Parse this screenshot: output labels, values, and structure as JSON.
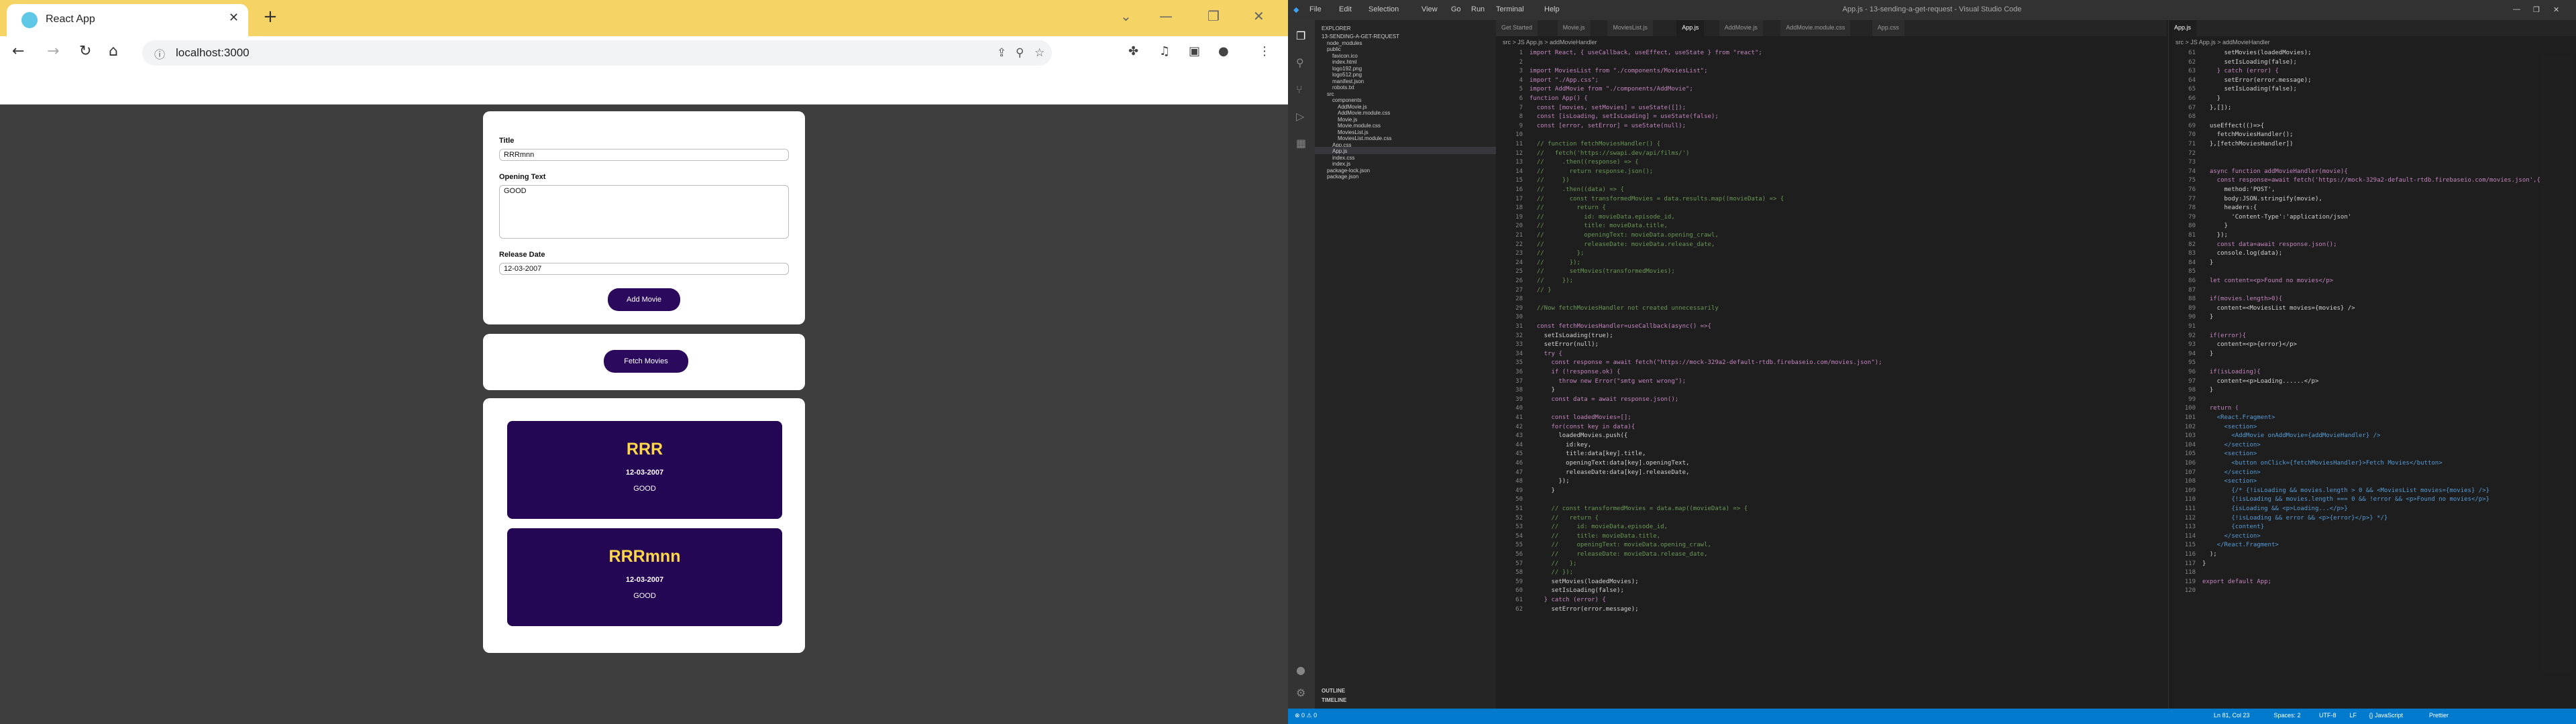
{
  "browser": {
    "tab_title": "React App",
    "url": "localhost:3000",
    "form": {
      "title_label": "Title",
      "title_value": "RRRmnn",
      "opening_label": "Opening Text",
      "opening_value": "GOOD",
      "release_label": "Release Date",
      "release_value": "12-03-2007",
      "add_button": "Add Movie"
    },
    "fetch_button": "Fetch Movies",
    "movies": [
      {
        "title": "RRR",
        "date": "12-03-2007",
        "opening": "GOOD"
      },
      {
        "title": "RRRmnn",
        "date": "12-03-2007",
        "opening": "GOOD"
      }
    ]
  },
  "vscode": {
    "window_title": "App.js - 13-sending-a-get-request - Visual Studio Code",
    "menu": [
      "File",
      "Edit",
      "Selection",
      "View",
      "Go",
      "Run",
      "Terminal",
      "Help"
    ],
    "explorer_title": "EXPLORER",
    "explorer_items": [
      {
        "label": "13-SENDING-A-GET-REQUEST",
        "indent": 0
      },
      {
        "label": "node_modules",
        "indent": 1
      },
      {
        "label": "public",
        "indent": 1
      },
      {
        "label": "favicon.ico",
        "indent": 2
      },
      {
        "label": "index.html",
        "indent": 2
      },
      {
        "label": "logo192.png",
        "indent": 2
      },
      {
        "label": "logo512.png",
        "indent": 2
      },
      {
        "label": "manifest.json",
        "indent": 2
      },
      {
        "label": "robots.txt",
        "indent": 2
      },
      {
        "label": "src",
        "indent": 1
      },
      {
        "label": "components",
        "indent": 2
      },
      {
        "label": "AddMovie.js",
        "indent": 3
      },
      {
        "label": "AddMovie.module.css",
        "indent": 3
      },
      {
        "label": "Movie.js",
        "indent": 3
      },
      {
        "label": "Movie.module.css",
        "indent": 3
      },
      {
        "label": "MoviesList.js",
        "indent": 3
      },
      {
        "label": "MoviesList.module.css",
        "indent": 3
      },
      {
        "label": "App.css",
        "indent": 2
      },
      {
        "label": "App.js",
        "indent": 2
      },
      {
        "label": "index.css",
        "indent": 2
      },
      {
        "label": "index.js",
        "indent": 2
      },
      {
        "label": "package-lock.json",
        "indent": 1
      },
      {
        "label": "package.json",
        "indent": 1
      }
    ],
    "outline": "OUTLINE",
    "timeline": "TIMELINE",
    "left_tabs": [
      "Get Started",
      "Movie.js",
      "MoviesList.js",
      "App.js",
      "AddMovie.js",
      "AddMovie.module.css",
      "App.css"
    ],
    "right_tabs": [
      "App.js"
    ],
    "left_crumb": "src > JS App.js > addMovieHandler",
    "right_crumb": "src > JS App.js > addMovieHandler",
    "left_code": [
      "import React, { useCallback, useEffect, useState } from \"react\";",
      "",
      "import MoviesList from \"./components/MoviesList\";",
      "import \"./App.css\";",
      "import AddMovie from \"./components/AddMovie\";",
      "function App() {",
      "  const [movies, setMovies] = useState([]);",
      "  const [isLoading, setIsLoading] = useState(false);",
      "  const [error, setError] = useState(null);",
      "",
      "  // function fetchMoviesHandler() {",
      "  //   fetch('https://swapi.dev/api/films/')",
      "  //     .then((response) => {",
      "  //       return response.json();",
      "  //     })",
      "  //     .then((data) => {",
      "  //       const transformedMovies = data.results.map((movieData) => {",
      "  //         return {",
      "  //           id: movieData.episode_id,",
      "  //           title: movieData.title,",
      "  //           openingText: movieData.opening_crawl,",
      "  //           releaseDate: movieData.release_date,",
      "  //         };",
      "  //       });",
      "  //       setMovies(transformedMovies);",
      "  //     });",
      "  // }",
      "",
      "  //Now fetchMoviesHandler not created unnecessarily",
      "",
      "  const fetchMoviesHandler=useCallback(async() =>{",
      "    setIsLoading(true);",
      "    setError(null);",
      "    try {",
      "      const response = await fetch(\"https://mock-329a2-default-rtdb.firebaseio.com/movies.json\");",
      "      if (!response.ok) {",
      "        throw new Error(\"smtg went wrong\");",
      "      }",
      "      const data = await response.json();",
      "",
      "      const loadedMovies=[];",
      "      for(const key in data){",
      "        loadedMovies.push({",
      "          id:key,",
      "          title:data[key].title,",
      "          openingText:data[key].openingText,",
      "          releaseDate:data[key].releaseDate,",
      "        });",
      "      }",
      "",
      "      // const transformedMovies = data.map((movieData) => {",
      "      //   return {",
      "      //     id: movieData.episode_id,",
      "      //     title: movieData.title,",
      "      //     openingText: movieData.opening_crawl,",
      "      //     releaseDate: movieData.release_date,",
      "      //   };",
      "      // });",
      "      setMovies(loadedMovies);",
      "      setIsLoading(false);",
      "    } catch (error) {",
      "      setError(error.message);"
    ],
    "right_start_line": 61,
    "right_code": [
      "      setMovies(loadedMovies);",
      "      setIsLoading(false);",
      "    } catch (error) {",
      "      setError(error.message);",
      "      setIsLoading(false);",
      "    }",
      "  },[]);",
      "",
      "  useEffect(()=>{",
      "    fetchMoviesHandler();",
      "  },[fetchMoviesHandler])",
      "",
      "",
      "  async function addMovieHandler(movie){",
      "    const response=await fetch('https://mock-329a2-default-rtdb.firebaseio.com/movies.json',{",
      "      method:'POST',",
      "      body:JSON.stringify(movie),",
      "      headers:{",
      "        'Content-Type':'application/json'",
      "      }",
      "    });",
      "    const data=await response.json();",
      "    console.log(data);",
      "  }",
      "",
      "  let content=<p>Found no movies</p>",
      "",
      "  if(movies.length>0){",
      "    content=<MoviesList movies={movies} />",
      "  }",
      "",
      "  if(error){",
      "    content=<p>{error}</p>",
      "  }",
      "",
      "  if(isLoading){",
      "    content=<p>Loading......</p>",
      "  }",
      "",
      "  return (",
      "    <React.Fragment>",
      "      <section>",
      "        <AddMovie onAddMovie={addMovieHandler} />",
      "      </section>",
      "      <section>",
      "        <button onClick={fetchMoviesHandler}>Fetch Movies</button>",
      "      </section>",
      "      <section>",
      "        {/* {!isLoading && movies.length > 0 && <MoviesList movies={movies} />}",
      "        {!isLoading && movies.length === 0 && !error && <p>Found no movies</p>}",
      "        {isLoading && <p>Loading...</p>}",
      "        {!isLoading && error && <p>{error}</p>} */}",
      "        {content}",
      "      </section>",
      "    </React.Fragment>",
      "  );",
      "}",
      "",
      "export default App;",
      ""
    ],
    "status_left": "⊗ 0 ⚠ 0",
    "status_right": [
      "Ln 81, Col 23",
      "Spaces: 2",
      "UTF-8",
      "LF",
      "{} JavaScript",
      "Prettier"
    ]
  },
  "colors": {
    "accent": "#2b0a5e",
    "movie_bg": "#230654",
    "movie_title": "#ffd84a",
    "tab_bar": "#f6d365",
    "status": "#007acc"
  }
}
